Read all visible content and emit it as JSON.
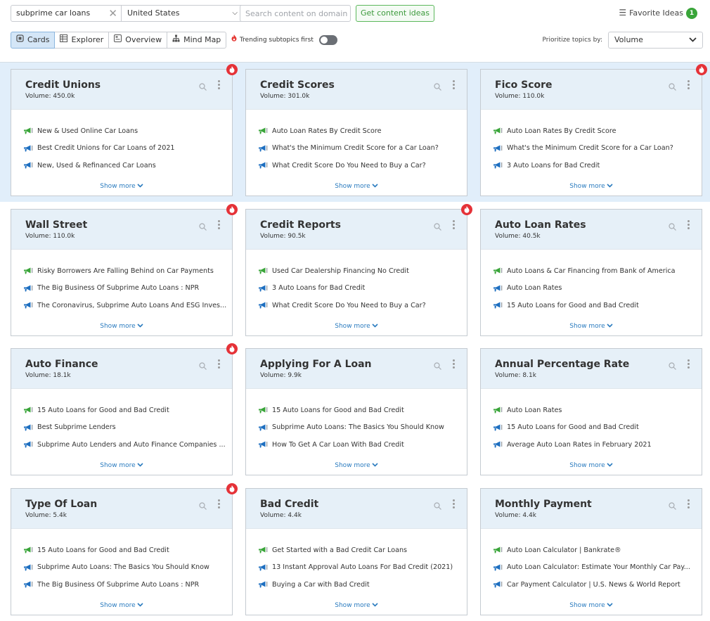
{
  "toolbar": {
    "search_value": "subprime car loans",
    "country": "United States",
    "domain_placeholder": "Search content on domain",
    "get_ideas_label": "Get content ideas",
    "favorites_label": "Favorite Ideas",
    "favorites_count": "1"
  },
  "views": {
    "tabs": [
      {
        "label": "Cards",
        "icon": "cards-icon",
        "active": true
      },
      {
        "label": "Explorer",
        "icon": "table-icon",
        "active": false
      },
      {
        "label": "Overview",
        "icon": "overview-icon",
        "active": false
      },
      {
        "label": "Mind Map",
        "icon": "mindmap-icon",
        "active": false
      }
    ],
    "trending_label": "Trending subtopics first",
    "trending_enabled": false,
    "prioritize_label": "Prioritize topics by:",
    "prioritize_value": "Volume"
  },
  "colors": {
    "accent_green": "#3aa53a",
    "accent_blue": "#2a7bbf",
    "trending_red": "#e53238",
    "card_header": "#e6f0f8",
    "band_highlight": "#e1eefa"
  },
  "common": {
    "volume_prefix": "Volume:",
    "show_more": "Show more"
  },
  "cards": [
    {
      "title": "Credit Unions",
      "volume": "450.0k",
      "trending": true,
      "ideas": [
        "New & Used Online Car Loans",
        "Best Credit Unions for Car Loans of 2021",
        "New, Used & Refinanced Car Loans"
      ]
    },
    {
      "title": "Credit Scores",
      "volume": "301.0k",
      "trending": false,
      "ideas": [
        "Auto Loan Rates By Credit Score",
        "What's the Minimum Credit Score for a Car Loan?",
        "What Credit Score Do You Need to Buy a Car?"
      ]
    },
    {
      "title": "Fico Score",
      "volume": "110.0k",
      "trending": true,
      "ideas": [
        "Auto Loan Rates By Credit Score",
        "What's the Minimum Credit Score for a Car Loan?",
        "3 Auto Loans for Bad Credit"
      ]
    },
    {
      "title": "Wall Street",
      "volume": "110.0k",
      "trending": true,
      "ideas": [
        "Risky Borrowers Are Falling Behind on Car Payments",
        "The Big Business Of Subprime Auto Loans : NPR",
        "The Coronavirus, Subprime Auto Loans And ESG Inves..."
      ]
    },
    {
      "title": "Credit Reports",
      "volume": "90.5k",
      "trending": true,
      "ideas": [
        "Used Car Dealership Financing No Credit",
        "3 Auto Loans for Bad Credit",
        "What Credit Score Do You Need to Buy a Car?"
      ]
    },
    {
      "title": "Auto Loan Rates",
      "volume": "40.5k",
      "trending": false,
      "ideas": [
        "Auto Loans & Car Financing from Bank of America",
        "Auto Loan Rates",
        "15 Auto Loans for Good and Bad Credit"
      ]
    },
    {
      "title": "Auto Finance",
      "volume": "18.1k",
      "trending": true,
      "ideas": [
        "15 Auto Loans for Good and Bad Credit",
        "Best Subprime Lenders",
        "Subprime Auto Lenders and Auto Finance Companies ..."
      ]
    },
    {
      "title": "Applying For A Loan",
      "volume": "9.9k",
      "trending": false,
      "ideas": [
        "15 Auto Loans for Good and Bad Credit",
        "Subprime Auto Loans: The Basics You Should Know",
        "How To Get A Car Loan With Bad Credit"
      ]
    },
    {
      "title": "Annual Percentage Rate",
      "volume": "8.1k",
      "trending": false,
      "ideas": [
        "Auto Loan Rates",
        "15 Auto Loans for Good and Bad Credit",
        "Average Auto Loan Rates in February 2021"
      ]
    },
    {
      "title": "Type Of Loan",
      "volume": "5.4k",
      "trending": true,
      "ideas": [
        "15 Auto Loans for Good and Bad Credit",
        "Subprime Auto Loans: The Basics You Should Know",
        "The Big Business Of Subprime Auto Loans : NPR"
      ]
    },
    {
      "title": "Bad Credit",
      "volume": "4.4k",
      "trending": false,
      "ideas": [
        "Get Started with a Bad Credit Car Loans",
        "13 Instant Approval Auto Loans For Bad Credit (2021)",
        "Buying a Car with Bad Credit"
      ]
    },
    {
      "title": "Monthly Payment",
      "volume": "4.4k",
      "trending": false,
      "ideas": [
        "Auto Loan Calculator | Bankrate®",
        "Auto Loan Calculator: Estimate Your Monthly Car Pay...",
        "Car Payment Calculator | U.S. News & World Report"
      ]
    }
  ]
}
